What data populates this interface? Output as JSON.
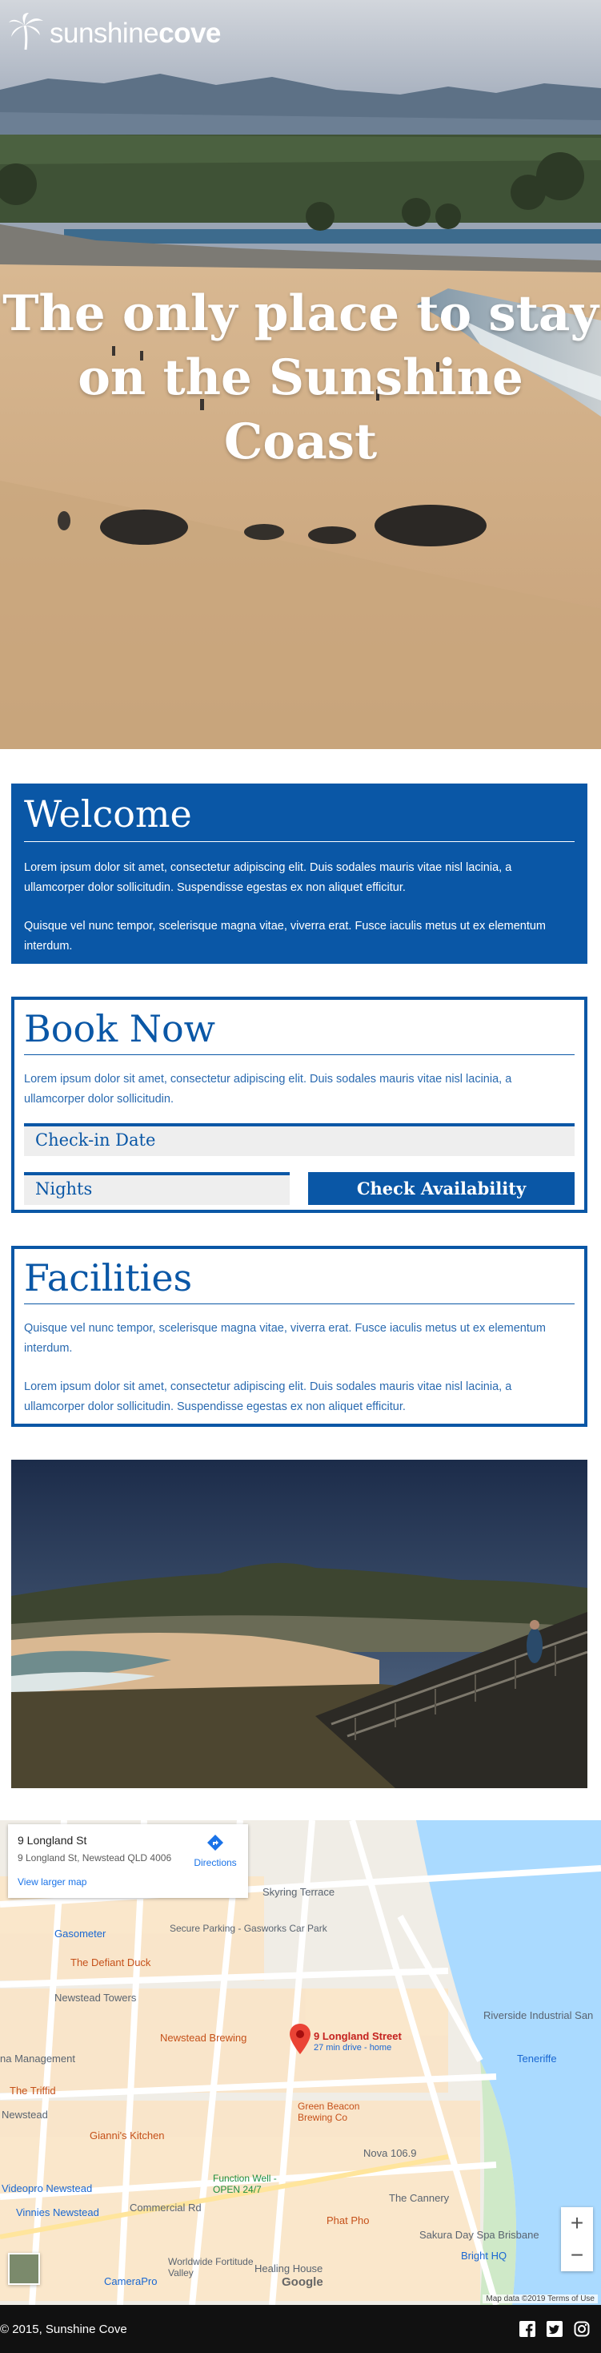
{
  "brand": {
    "prefix": "sunshine",
    "suffix": "cove"
  },
  "hero": {
    "headline": "The only place to stay on the Sunshine Coast"
  },
  "welcome": {
    "title": "Welcome",
    "paragraphs": [
      "Lorem ipsum dolor sit amet, consectetur adipiscing elit. Duis sodales mauris vitae nisl lacinia, a ullamcorper dolor sollicitudin. Suspendisse egestas ex non aliquet efficitur.",
      "Quisque vel nunc tempor, scelerisque magna vitae, viverra erat. Fusce iaculis metus ut ex elementum interdum."
    ]
  },
  "book": {
    "title": "Book Now",
    "text": "Lorem ipsum dolor sit amet, consectetur adipiscing elit. Duis sodales mauris vitae nisl lacinia, a ullamcorper dolor sollicitudin.",
    "checkin_placeholder": "Check-in Date",
    "nights_placeholder": "Nights",
    "submit_label": "Check Availability"
  },
  "facilities": {
    "title": "Facilities",
    "paragraphs": [
      "Quisque vel nunc tempor, scelerisque magna vitae, viverra erat. Fusce iaculis metus ut ex elementum interdum.",
      "Lorem ipsum dolor sit amet, consectetur adipiscing elit. Duis sodales mauris vitae nisl lacinia, a ullamcorper dolor sollicitudin. Suspendisse egestas ex non aliquet efficitur."
    ]
  },
  "map": {
    "place_title": "9 Longland St",
    "place_address": "9 Longland St, Newstead QLD 4006",
    "directions_label": "Directions",
    "larger_map_label": "View larger map",
    "pin_label": "9 Longland Street",
    "pin_sublabel": "27 min drive - home",
    "zoom_in": "+",
    "zoom_out": "−",
    "attribution": "Map data ©2019   Terms of Use",
    "labels": [
      "Skyring Terrace",
      "Gasometer",
      "Secure Parking - Gasworks Car Park",
      "The Defiant Duck",
      "Newstead Towers",
      "Newstead Brewing",
      "Riverside Industrial San",
      "Teneriffe",
      "na Management",
      "The Triffid",
      "Newstead",
      "Gianni's Kitchen",
      "Green Beacon Brewing Co",
      "Nova 106.9",
      "The Cannery",
      "Function Well - OPEN 24/7",
      "Videopro Newstead",
      "Vinnies Newstead",
      "Commercial Rd",
      "Phat Pho",
      "Sakura Day Spa Brisbane",
      "Bright HQ",
      "Worldwide Fortitude Valley",
      "Healing House",
      "CameraPro",
      "Google"
    ]
  },
  "footer": {
    "copyright": "© 2015, Sunshine Cove"
  },
  "colors": {
    "brand_blue": "#0a57a6",
    "footer_bg": "#111111"
  },
  "icons": [
    "palm-tree-icon",
    "directions-icon",
    "map-pin-icon",
    "facebook-icon",
    "twitter-icon",
    "instagram-icon"
  ]
}
